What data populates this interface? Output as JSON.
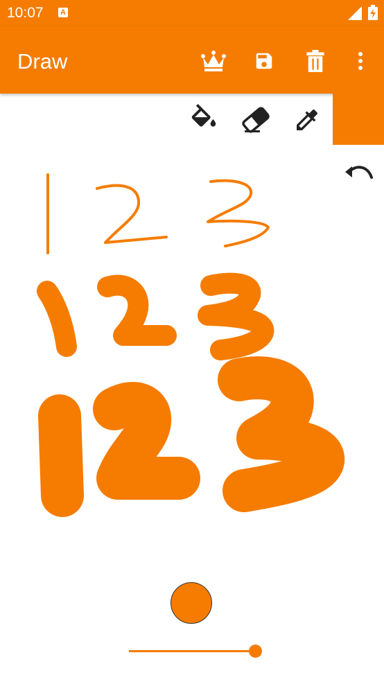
{
  "status_bar": {
    "time": "10:07",
    "notification_icon": "a-icon"
  },
  "app_bar": {
    "title": "Draw",
    "actions": [
      "crown-icon",
      "save-icon",
      "delete-icon",
      "more-vert-icon"
    ]
  },
  "tools": [
    "fill-bucket-icon",
    "eraser-icon",
    "eyedropper-icon"
  ],
  "colors": {
    "accent": "#f57c00",
    "selected_color": "#f57c00"
  },
  "brush": {
    "size_fraction": 1.0
  }
}
